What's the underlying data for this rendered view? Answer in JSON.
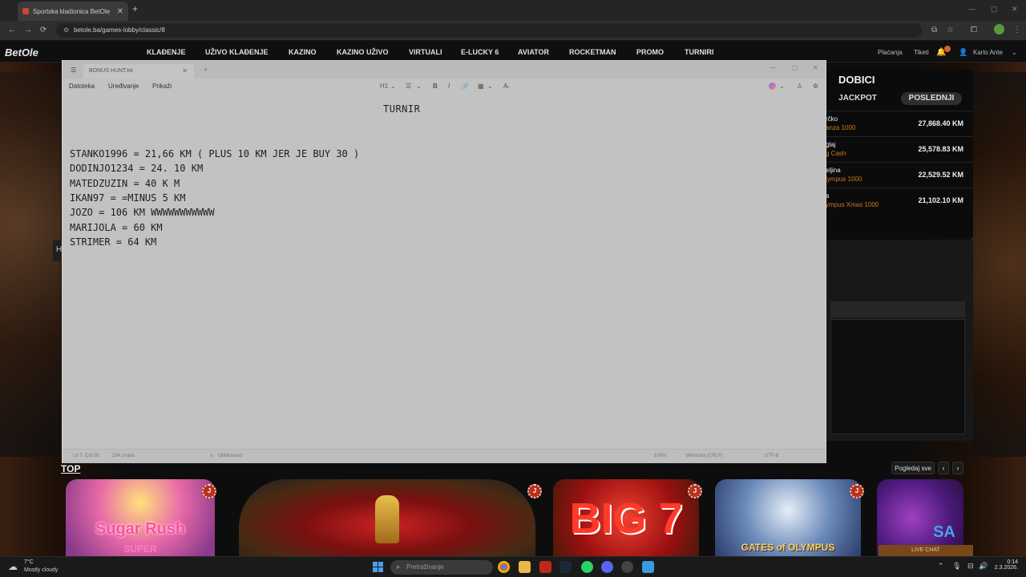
{
  "browser": {
    "tab_title": "Sportska kladionica BetOle",
    "url": "betole.ba/games-lobby/classic/8",
    "new_tab": "+",
    "tab_close": "✕"
  },
  "site": {
    "logo": "BetOle",
    "nav": [
      "KLAĐENJE",
      "UŽIVO KLAĐENJE",
      "KAZINO",
      "KAZINO UŽIVO",
      "VIRTUALI",
      "E-LUCKY 6",
      "AVIATOR",
      "ROCKETMAN",
      "PROMO",
      "TURNIRI"
    ],
    "right": {
      "payments": "Plaćanja",
      "tickets": "Tiketi",
      "user": "Karlo Ante"
    }
  },
  "dobici": {
    "title": "DOBICI",
    "tabs": [
      "JACKPOT",
      "POSLEDNJI"
    ],
    "rows": [
      {
        "name": "rčko",
        "game": "anza 1000",
        "amount": "27,868.40 KM"
      },
      {
        "name": "glaj",
        "game": "g Cash",
        "amount": "25,578.83 KM"
      },
      {
        "name": "eljina",
        "game": "lympus 1000",
        "amount": "22,529.52 KM"
      },
      {
        "name": "a",
        "game": "ympus Xmas 1000",
        "amount": "21,102.10 KM"
      }
    ]
  },
  "left_strip": "H",
  "games": {
    "section_label": "TOP",
    "see_all": "Pogledaj sve",
    "prev": "‹",
    "next": "›",
    "chip": "J",
    "tiles": [
      {
        "label": "Sugar Rush",
        "sub": "SUPER"
      },
      {
        "label": ""
      },
      {
        "label": "BIG 7"
      },
      {
        "label": "GATES of OLYMPUS"
      },
      {
        "label": "SA"
      }
    ],
    "live_chat": "LIVE CHAT"
  },
  "notepad": {
    "tab_title": "BONUS HUNT.txt",
    "menu": [
      "Datoteka",
      "Uređivanje",
      "Prikaži"
    ],
    "toolbar": {
      "heading": "H1",
      "list": "☰",
      "bold": "B",
      "italic": "I",
      "link": "🔗",
      "table": "▦",
      "clear": "A̶"
    },
    "heading": "TURNIR",
    "lines": [
      "STANKO1996 = 21,66 KM ( PLUS 10 KM JER JE BUY 30 )",
      "DODINJO1234 = 24. 10 KM",
      "MATEDZUZIN = 40 K M",
      "IKAN97 = =MINUS 5 KM",
      "JOZO = 106 KM WWWWWWWWWWW",
      "MARIJOLA = 60 KM",
      "STRIMER = 64 KM"
    ],
    "status": {
      "position": "Ln 7, Col 16",
      "chars": "234 znaka",
      "format": "Oblikovano",
      "zoom": "100%",
      "eol": "Windows (CRLF)",
      "encoding": "UTF-8"
    }
  },
  "taskbar": {
    "temp": "7°C",
    "weather": "Mostly cloudy",
    "search_placeholder": "Pretraživanje",
    "time": "0:14",
    "date": "2.3.2026."
  },
  "colors": {
    "accent": "#d4751a",
    "chip": "#b8301f",
    "windows_blue": "#4aa0e8"
  }
}
